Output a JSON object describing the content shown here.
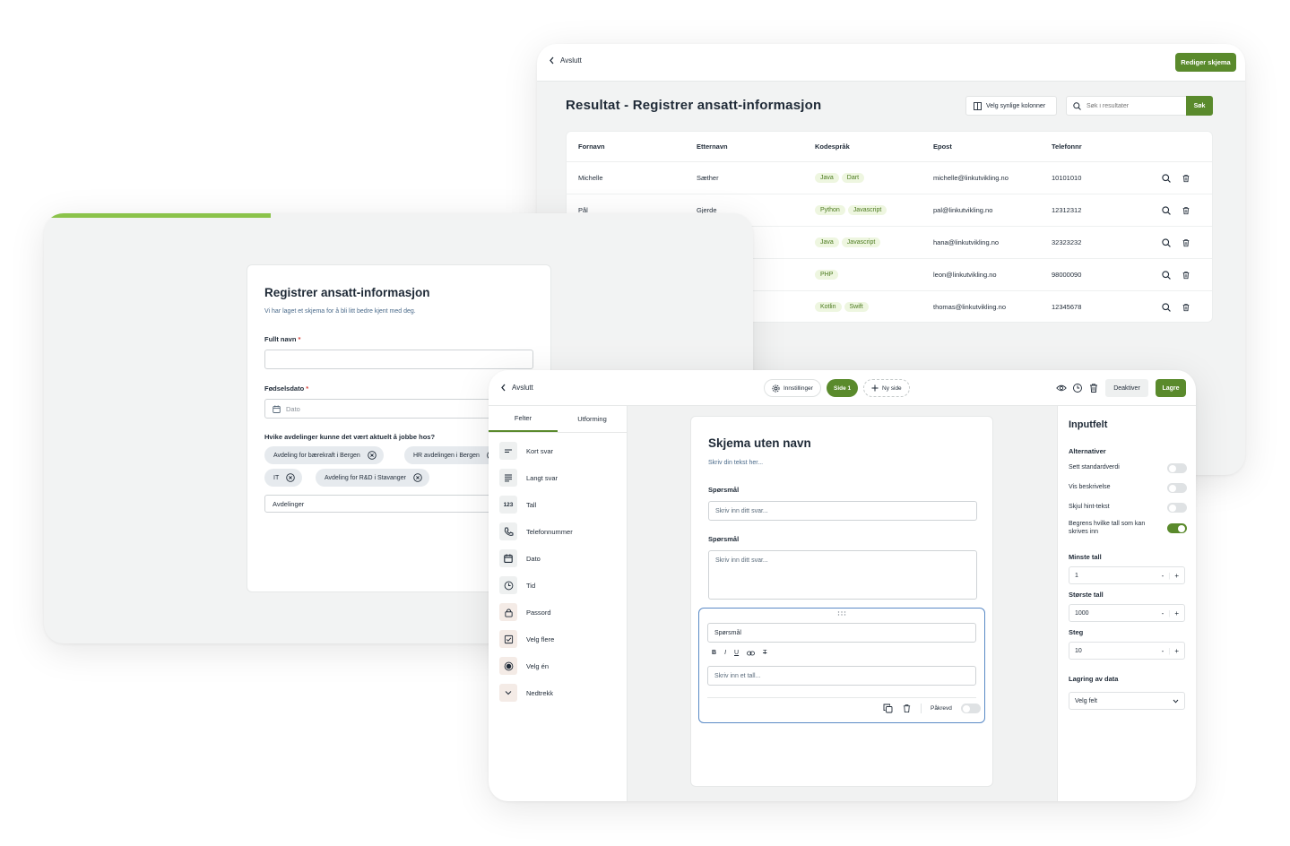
{
  "results": {
    "back_label": "Avslutt",
    "edit_label": "Rediger skjema",
    "title": "Resultat - Registrer ansatt-informasjon",
    "columns_label": "Velg synlige kolonner",
    "search_placeholder": "Søk i resultater",
    "search_label": "Søk",
    "headers": [
      "Fornavn",
      "Etternavn",
      "Kodespråk",
      "Epost",
      "Telefonnr"
    ],
    "rows": [
      {
        "first": "Michelle",
        "last": "Sæther",
        "tags": [
          "Java",
          "Dart"
        ],
        "email": "michelle@linkutvikling.no",
        "phone": "10101010"
      },
      {
        "first": "Pål",
        "last": "Gjerde",
        "tags": [
          "Python",
          "Javascript"
        ],
        "email": "pal@linkutvikling.no",
        "phone": "12312312"
      },
      {
        "first": "",
        "last": "",
        "tags": [
          "Java",
          "Javascript"
        ],
        "email": "hana@linkutvikling.no",
        "phone": "32323232"
      },
      {
        "first": "",
        "last": "",
        "tags": [
          "PHP"
        ],
        "email": "leon@linkutvikling.no",
        "phone": "98000090"
      },
      {
        "first": "",
        "last": "",
        "tags": [
          "Kotlin",
          "Swift"
        ],
        "email": "thomas@linkutvikling.no",
        "phone": "12345678"
      }
    ]
  },
  "form": {
    "progress": 0.32,
    "title": "Registrer ansatt-informasjon",
    "subtitle": "Vi har laget et skjema for å bli litt bedre kjent med deg.",
    "name_label": "Fullt navn",
    "required_mark": "*",
    "birth_label": "Fødselsdato",
    "date_placeholder": "Dato",
    "dept_label": "Hvike avdelinger kunne det vært aktuelt å jobbe hos?",
    "chips": [
      "Avdeling for bærekraft i Bergen",
      "HR avdelingen i Bergen",
      "IT",
      "Avdeling for R&D i Stavanger"
    ],
    "dept_placeholder": "Avdelinger"
  },
  "builder": {
    "back_label": "Avslutt",
    "settings_label": "Innstillinger",
    "page_label": "Side 1",
    "new_page_label": "Ny side",
    "deactivate_label": "Deaktiver",
    "save_label": "Lagre",
    "tabs": [
      "Felter",
      "Utforming"
    ],
    "field_types": [
      {
        "label": "Kort svar",
        "icon": "short-text-icon"
      },
      {
        "label": "Langt svar",
        "icon": "long-text-icon"
      },
      {
        "label": "Tall",
        "icon": "number-icon",
        "glyph": "123"
      },
      {
        "label": "Telefonnummer",
        "icon": "phone-icon"
      },
      {
        "label": "Dato",
        "icon": "calendar-icon"
      },
      {
        "label": "Tid",
        "icon": "clock-icon"
      },
      {
        "label": "Passord",
        "icon": "lock-icon"
      },
      {
        "label": "Velg flere",
        "icon": "checkbox-icon"
      },
      {
        "label": "Velg én",
        "icon": "radio-icon"
      },
      {
        "label": "Nedtrekk",
        "icon": "chevron-down-icon"
      }
    ],
    "canvas": {
      "title": "Skjema uten navn",
      "subtitle": "Skriv din tekst her...",
      "q1_label": "Spørsmål",
      "q1_placeholder": "Skriv inn ditt svar...",
      "q2_label": "Spørsmål",
      "q2_placeholder": "Skriv inn ditt svar...",
      "q3_value": "Spørsmål",
      "q3_placeholder": "Skriv inn et tall...",
      "required_label": "Påkrevd",
      "format_bold": "B",
      "format_italic": "I",
      "format_underline": "U",
      "format_clear": "T"
    },
    "panel": {
      "title": "Inputfelt",
      "alt_label": "Alternativer",
      "options": [
        {
          "label": "Sett standardverdi",
          "on": false
        },
        {
          "label": "Vis beskrivelse",
          "on": false
        },
        {
          "label": "Skjul hint-tekst",
          "on": false
        },
        {
          "label": "Begrens hvilke tall som kan skrives inn",
          "on": true
        }
      ],
      "min_label": "Minste tall",
      "min_value": "1",
      "max_label": "Største tall",
      "max_value": "1000",
      "step_label": "Steg",
      "step_value": "10",
      "storage_label": "Lagring av data",
      "storage_value": "Velg felt",
      "minus": "-",
      "plus": "+"
    }
  },
  "colors": {
    "accent": "#5a8a2c",
    "progress": "#8bc34a",
    "tag_bg": "#eef6e0",
    "focus": "#5a8ac6"
  }
}
